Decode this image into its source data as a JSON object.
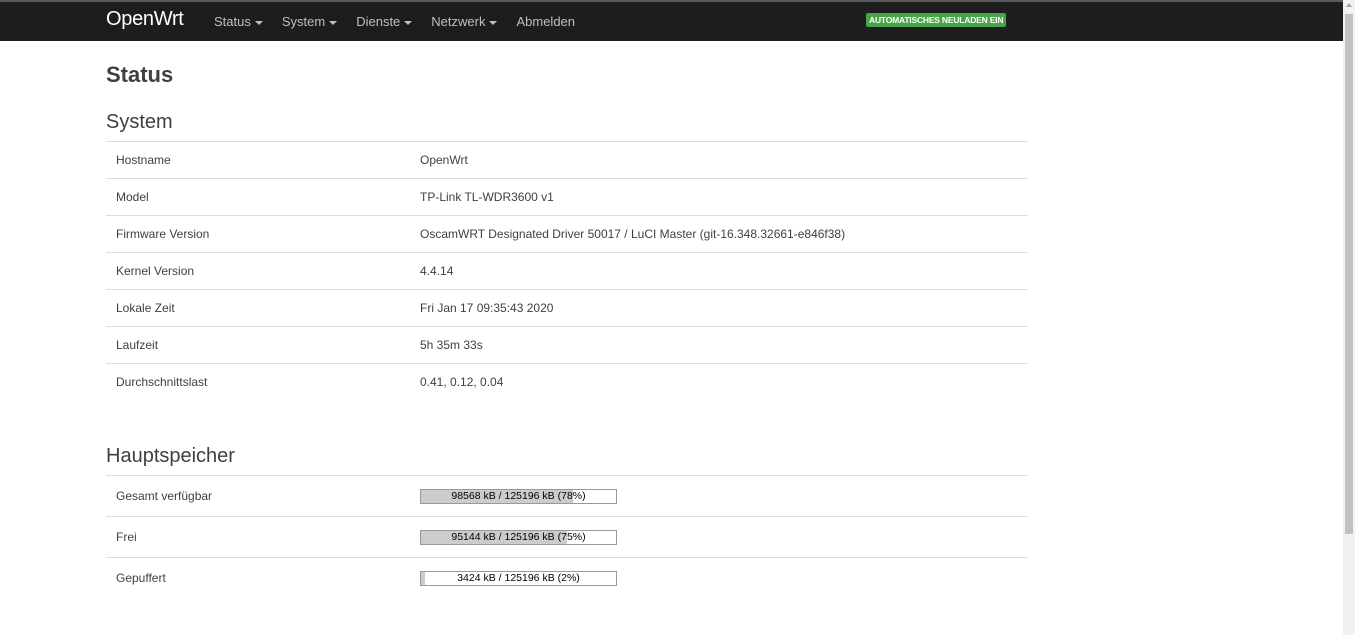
{
  "navbar": {
    "brand": "OpenWrt",
    "menu": [
      {
        "label": "Status",
        "has_caret": true
      },
      {
        "label": "System",
        "has_caret": true
      },
      {
        "label": "Dienste",
        "has_caret": true
      },
      {
        "label": "Netzwerk",
        "has_caret": true
      },
      {
        "label": "Abmelden",
        "has_caret": false
      }
    ],
    "reload_badge": "AUTOMATISCHES NEULADEN EIN"
  },
  "page": {
    "title": "Status"
  },
  "system": {
    "heading": "System",
    "rows": [
      {
        "label": "Hostname",
        "value": "OpenWrt"
      },
      {
        "label": "Model",
        "value": "TP-Link TL-WDR3600 v1"
      },
      {
        "label": "Firmware Version",
        "value": "OscamWRT Designated Driver 50017 / LuCI Master (git-16.348.32661-e846f38)"
      },
      {
        "label": "Kernel Version",
        "value": "4.4.14"
      },
      {
        "label": "Lokale Zeit",
        "value": "Fri Jan 17 09:35:43 2020"
      },
      {
        "label": "Laufzeit",
        "value": "5h 35m 33s"
      },
      {
        "label": "Durchschnittslast",
        "value": "0.41, 0.12, 0.04"
      }
    ]
  },
  "memory": {
    "heading": "Hauptspeicher",
    "rows": [
      {
        "label": "Gesamt verfügbar",
        "text": "98568 kB / 125196 kB (78%)",
        "fraction": 0.78
      },
      {
        "label": "Frei",
        "text": "95144 kB / 125196 kB (75%)",
        "fraction": 0.75
      },
      {
        "label": "Gepuffert",
        "text": "3424 kB / 125196 kB (2%)",
        "fraction": 0.02
      }
    ]
  },
  "colors": {
    "navbar_bg": "#1d1d1d",
    "badge_green": "#46a546",
    "bar_fill": "#cccccc"
  }
}
